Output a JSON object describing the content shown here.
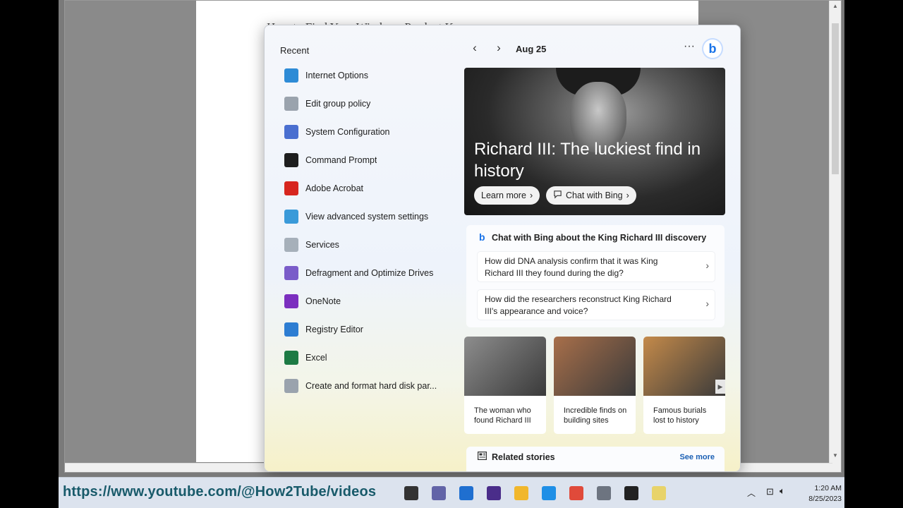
{
  "document": {
    "heading_fragment": "How to Find Your Windows Product Key"
  },
  "search_panel": {
    "recent_title": "Recent",
    "recent_items": [
      {
        "label": "Internet Options",
        "icon": "internet-options-icon",
        "color": "#2e8bd6"
      },
      {
        "label": "Edit group policy",
        "icon": "group-policy-icon",
        "color": "#9aa3ad"
      },
      {
        "label": "System Configuration",
        "icon": "system-configuration-icon",
        "color": "#4a6fd0"
      },
      {
        "label": "Command Prompt",
        "icon": "command-prompt-icon",
        "color": "#1e1e1e"
      },
      {
        "label": "Adobe Acrobat",
        "icon": "adobe-acrobat-icon",
        "color": "#d7261e"
      },
      {
        "label": "View advanced system settings",
        "icon": "system-settings-icon",
        "color": "#3a9ad9"
      },
      {
        "label": "Services",
        "icon": "services-icon",
        "color": "#a6b0ba"
      },
      {
        "label": "Defragment and Optimize Drives",
        "icon": "defragment-icon",
        "color": "#7a5cc9"
      },
      {
        "label": "OneNote",
        "icon": "onenote-icon",
        "color": "#7b2fbf"
      },
      {
        "label": "Registry Editor",
        "icon": "registry-editor-icon",
        "color": "#2d7dd2"
      },
      {
        "label": "Excel",
        "icon": "excel-icon",
        "color": "#1d7a44"
      },
      {
        "label": "Create and format hard disk par...",
        "icon": "disk-management-icon",
        "color": "#9aa3ad"
      }
    ],
    "date": "Aug 25",
    "more_label": "···",
    "bing_label": "b",
    "hero": {
      "title": "Richard III: The luckiest find in history",
      "learn_more": "Learn more",
      "chat_with_bing": "Chat with Bing"
    },
    "chat_card": {
      "title": "Chat with Bing about the King Richard III discovery",
      "questions": [
        "How did DNA analysis confirm that it was King Richard III they found during the dig?",
        "How did the researchers reconstruct King Richard III's appearance and voice?"
      ]
    },
    "stories": [
      {
        "caption": "The woman who found Richard III",
        "tone": "#8d8d8d"
      },
      {
        "caption": "Incredible finds on building sites",
        "tone": "#a86f4a"
      },
      {
        "caption": "Famous burials lost to history",
        "tone": "#c48a4a"
      }
    ],
    "related": {
      "title": "Related stories",
      "see_more": "See more"
    }
  },
  "taskbar": {
    "watermark": "https://www.youtube.com/@How2Tube/videos",
    "clock_time": "1:20 AM",
    "clock_date": "8/25/2023",
    "pinned": [
      {
        "icon": "task-view-icon",
        "color": "#333333"
      },
      {
        "icon": "teams-chat-icon",
        "color": "#6264a7"
      },
      {
        "icon": "microsoft-store-icon",
        "color": "#1f6fd0"
      },
      {
        "icon": "media-player-icon",
        "color": "#4a2d8a"
      },
      {
        "icon": "file-explorer-icon",
        "color": "#f1b72c"
      },
      {
        "icon": "activity-monitor-icon",
        "color": "#1f8fe6"
      },
      {
        "icon": "chrome-icon",
        "color": "#e04a3a"
      },
      {
        "icon": "settings-icon",
        "color": "#6d7480"
      },
      {
        "icon": "terminal-icon",
        "color": "#222222"
      },
      {
        "icon": "notepad-icon",
        "color": "#e8d36a"
      }
    ]
  }
}
